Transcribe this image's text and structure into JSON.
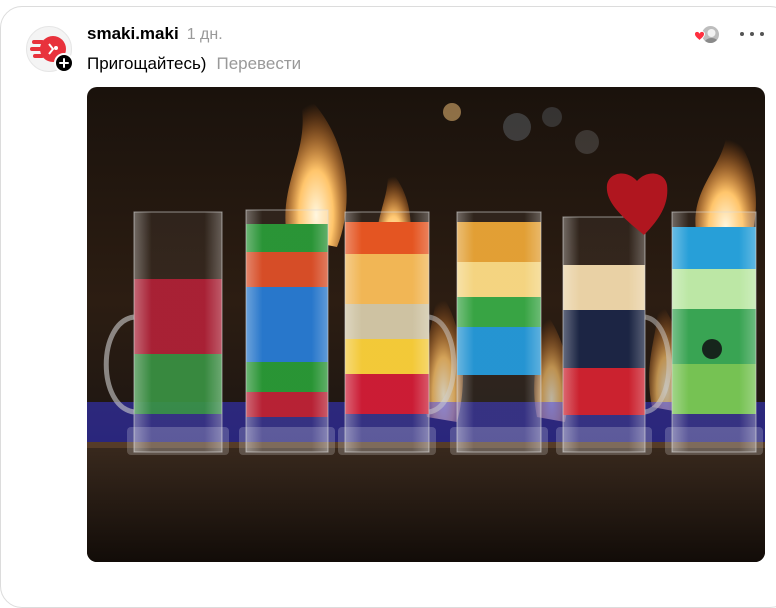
{
  "post": {
    "username": "smaki.maki",
    "time": "1 дн.",
    "caption": "Пригощайтесь)",
    "translate_label": "Перевести"
  },
  "icons": {
    "avatar": "smaki-maki-logo",
    "follow": "plus-icon",
    "liked_by": "heart-icon",
    "more": "more-horizontal-icon"
  },
  "colors": {
    "text": "#000000",
    "muted": "#999999",
    "heart": "#ff3040",
    "logo_red": "#e8323c"
  }
}
